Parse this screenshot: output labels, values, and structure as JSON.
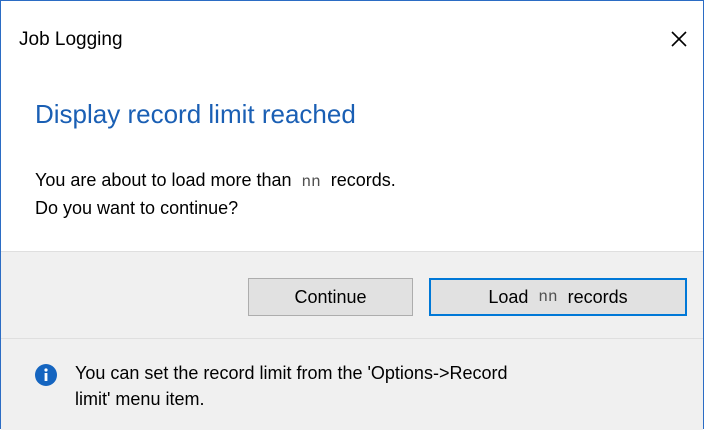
{
  "window": {
    "title": "Job Logging",
    "close_icon": "close-icon"
  },
  "main": {
    "instruction": "Display record limit reached",
    "message_line1_before": "You are about to load more than",
    "placeholder": "nn",
    "message_line1_after": "records.",
    "message_line2": "Do you want to continue?"
  },
  "buttons": {
    "continue_label": "Continue",
    "load_prefix": "Load",
    "load_placeholder": "nn",
    "load_suffix": "records"
  },
  "footer": {
    "icon": "info-icon",
    "line1": "You can set the record limit from the 'Options->Record",
    "line2": "limit' menu item."
  },
  "colors": {
    "accent": "#0078d7",
    "instruction_text": "#1a5fb4",
    "info_icon": "#1565c0",
    "button_face": "#e1e1e1",
    "panel_background": "#f0f0f0"
  }
}
